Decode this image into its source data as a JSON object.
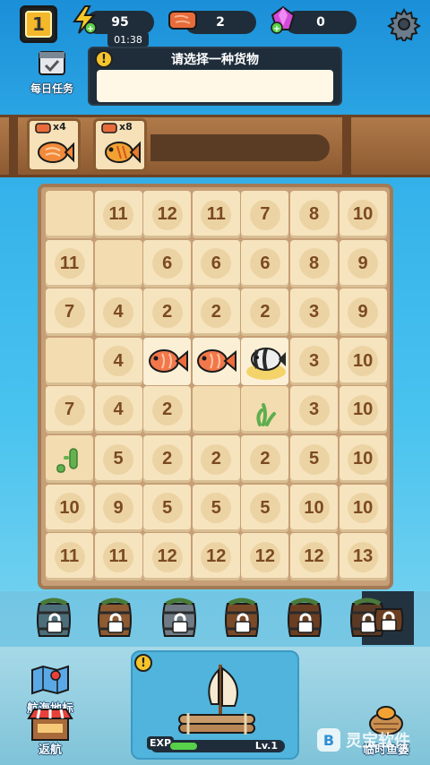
{
  "top_bar": {
    "level": "1",
    "energy": "95",
    "energy_timer": "01:38",
    "fish_count": "2",
    "gems": "0"
  },
  "daily_task": {
    "label": "每日任务"
  },
  "prompt": {
    "title": "请选择一种货物",
    "icon": "warning-icon"
  },
  "cargo": [
    {
      "count": "x4",
      "icon": "fish-fillet-icon"
    },
    {
      "count": "x8",
      "icon": "whole-fish-icon"
    }
  ],
  "board": {
    "rows": [
      [
        "",
        "11",
        "12",
        "11",
        "7",
        "8",
        "10"
      ],
      [
        "11",
        "",
        "6",
        "6",
        "6",
        "8",
        "9"
      ],
      [
        "7",
        "4",
        "2",
        "2",
        "2",
        "3",
        "9"
      ],
      [
        "",
        "4",
        "fish",
        "fish",
        "clownfish",
        "3",
        "10"
      ],
      [
        "7",
        "4",
        "2",
        "",
        "seaweed",
        "3",
        "10"
      ],
      [
        "cactus",
        "5",
        "2",
        "2",
        "2",
        "5",
        "10"
      ],
      [
        "10",
        "9",
        "5",
        "5",
        "5",
        "10",
        "10"
      ],
      [
        "11",
        "11",
        "12",
        "12",
        "12",
        "12",
        "13"
      ]
    ]
  },
  "barrels": [
    {
      "locked": true
    },
    {
      "locked": true
    },
    {
      "locked": true
    },
    {
      "locked": true
    },
    {
      "locked": true
    },
    {
      "locked": true
    },
    {
      "locked": true
    }
  ],
  "bottom": {
    "nav_map_label": "航海地标",
    "return_label": "返航",
    "exp_label": "EXP",
    "level_label": "Lv.1",
    "exp_progress": 0.3,
    "right_label": "临时鱼篓"
  },
  "watermark": {
    "text": "灵宝软件"
  },
  "colors": {
    "accent": "#f5b82a",
    "board": "#c79f76",
    "cell": "#f6e4bf",
    "number": "#7b4a22"
  }
}
